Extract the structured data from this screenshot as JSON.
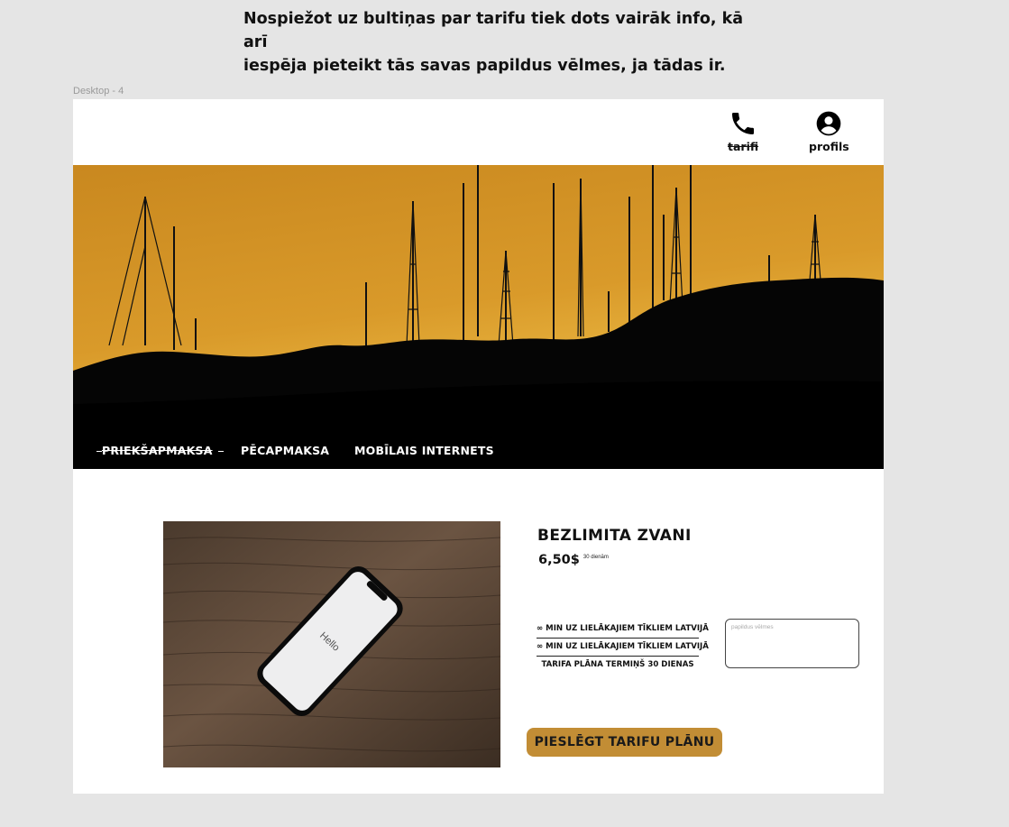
{
  "annotation": {
    "line1": "Nospiežot uz bultiņas par tarifu tiek dots vairāk info, kā arī",
    "line2": "iespēja pieteikt tās savas papildus vēlmes, ja tādas ir."
  },
  "frame_label": "Desktop - 4",
  "header": {
    "items": [
      {
        "label": "tarifi",
        "icon": "phone-icon"
      },
      {
        "label": "profils",
        "icon": "user-circle-icon"
      }
    ]
  },
  "tabs": [
    {
      "label": "PRIEKŠAPMAKSA"
    },
    {
      "label": "PĒCAPMAKSA"
    },
    {
      "label": "MOBĪLAIS INTERNETS"
    }
  ],
  "product": {
    "phone_screen_text": "Hello",
    "title": "BEZLIMITA ZVANI",
    "price": "6,50$",
    "price_period": "30 dienām",
    "features": [
      "∞ MIN UZ LIELĀKAJIEM TĪKLIEM LATVIJĀ",
      "∞ MIN UZ LIELĀKAJIEM TĪKLIEM LATVIJĀ",
      "TARIFA PLĀNA TERMIŅŠ 30 DIENAS"
    ],
    "wishes_placeholder": "papildus vēlmes",
    "cta_label": "PIESLĒGT TARIFU PLĀNU"
  },
  "colors": {
    "page_bg": "#e5e5e5",
    "frame_bg": "#ffffff",
    "accent": "#c28d35",
    "sky_top": "#c9881f",
    "sky_bottom": "#f0c24a",
    "silhouette": "#050505"
  }
}
